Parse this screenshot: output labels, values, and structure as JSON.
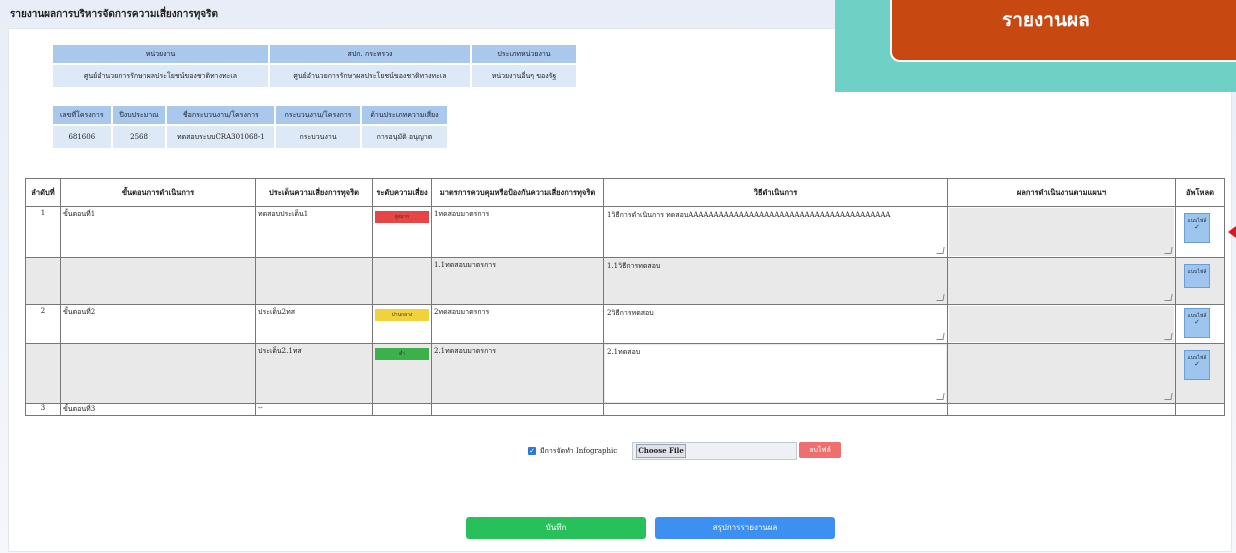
{
  "page_title": "รายงานผลการบริหารจัดการความเสี่ยงการทุจริต",
  "badge": "รายงานผล",
  "org_table": {
    "headers": [
      "หน่วยงาน",
      "สปก. กระทรวง",
      "ประเภทหน่วยงาน"
    ],
    "values": [
      "ศูนย์อำนวยการรักษาผลประโยชน์ของชาติทางทะเล",
      "ศูนย์อำนวยการรักษาผลประโยชน์ของชาติทางทะเล",
      "หน่วยงานอื่นๆ ของรัฐ"
    ]
  },
  "project_table": {
    "headers": [
      "เลขที่โครงการ",
      "ปีงบประมาณ",
      "ชื่อกระบวนงาน/โครงการ",
      "กระบวนงาน/โครงการ",
      "ด้านประเภทความเสี่ยง"
    ],
    "values": [
      "681606",
      "2568",
      "ทดสอบระบบCRA301068-1",
      "กระบวนงาน",
      "การอนุมัติ อนุญาต"
    ]
  },
  "main_table": {
    "headers": [
      "ลำดับที่",
      "ขั้นตอนการดำเนินการ",
      "ประเด็นความเสี่ยงการทุจริต",
      "ระดับความเสี่ยง",
      "มาตรการควบคุมหรือป้องกันความเสี่ยงการทุจริต",
      "วิธีดำเนินการ",
      "ผลการดำเนินงานตามแผนฯ",
      "อัพโหลด"
    ],
    "rows": [
      {
        "no": "1",
        "step": "ขั้นตอนที่1",
        "issue": "ทดสอบประเด็น1",
        "level": "สูงมาก",
        "measure": "1ทดสอบมาตรการ",
        "method": "1วิธีการดำเนินการ ทดสอบAAAAAAAAAAAAAAAAAAAAAAAAAAAAAAAAAAAAAAAA"
      },
      {
        "measure": "1.1ทดสอบมาตรการ",
        "method": "1.1วิธีการทดสอบ"
      },
      {
        "no": "2",
        "step": "ขั้นตอนที่2",
        "issue": "ประเด็น2ทส",
        "level": "ปานกลาง",
        "measure": "2ทดสอบมาตรการ",
        "method": "2วิธีการทดสอบ"
      },
      {
        "issue": "ประเด็น2.1ทส",
        "level": "ต่ำ",
        "measure": "2.1ทดสอบมาตรการ",
        "method": "2.1ทดสอบ"
      },
      {
        "no": "3",
        "step": "ขั้นตอนที่3",
        "issue": "--"
      }
    ],
    "upload_label": "แนบไฟล์",
    "upload_check": "✓"
  },
  "infographic_label": "มีการจัดทำ Infographic",
  "file_button": "Choose File",
  "delete_button": "ลบไฟล์",
  "save_button": "บันทึก",
  "summary_button": "สรุปการรายงานผล",
  "colors": {
    "high": "#e64646",
    "medium": "#f2d23a",
    "low": "#3cb04a"
  }
}
